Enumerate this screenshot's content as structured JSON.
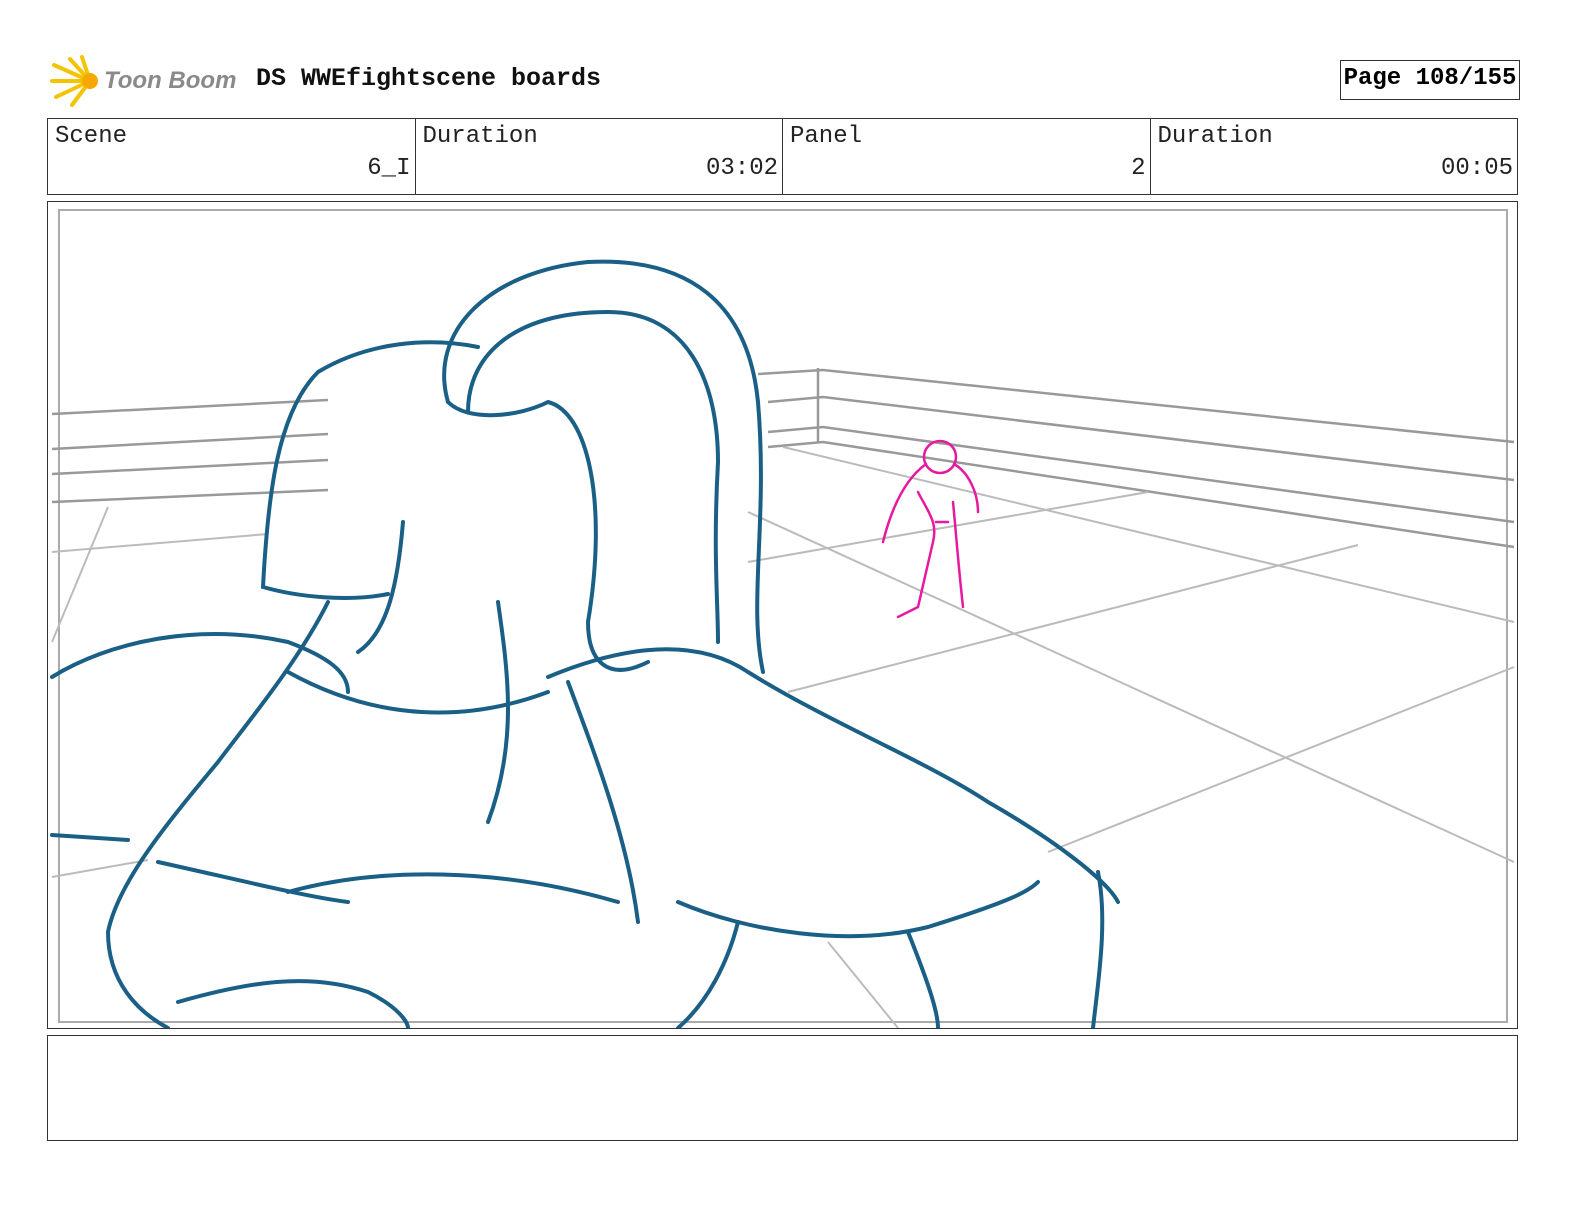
{
  "header": {
    "logo_text": "Toon Boom",
    "title": "DS WWEfightscene boards",
    "page": "Page 108/155"
  },
  "info": [
    {
      "label": "Scene",
      "value": "6_I"
    },
    {
      "label": "Duration",
      "value": "03:02"
    },
    {
      "label": "Panel",
      "value": "2"
    },
    {
      "label": "Duration",
      "value": "00:05"
    }
  ],
  "colors": {
    "sketch_main": "#1a5f86",
    "sketch_figure": "#e6199f",
    "grid": "#aaaaaa"
  },
  "notes": ""
}
